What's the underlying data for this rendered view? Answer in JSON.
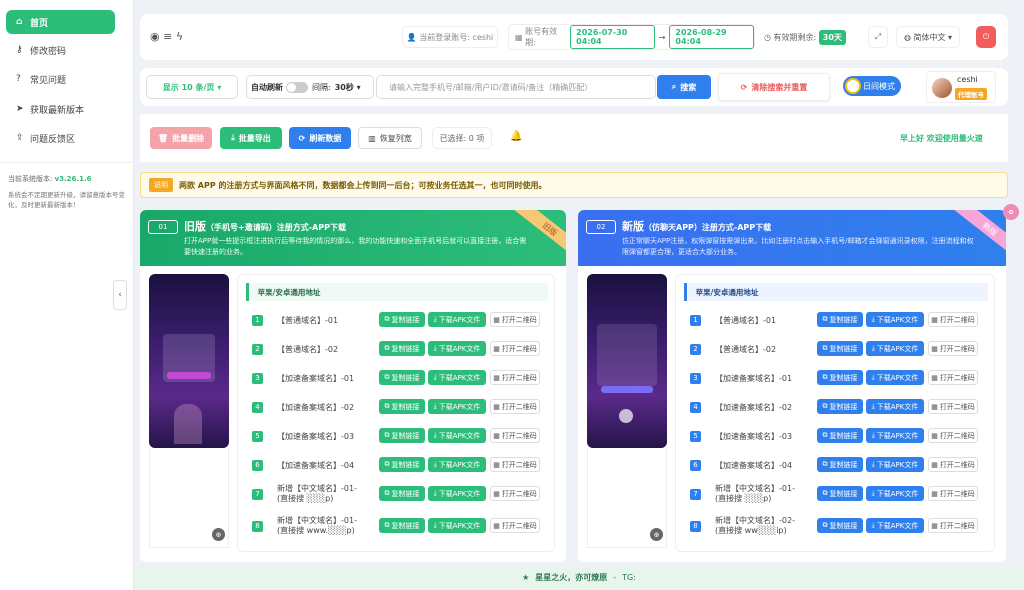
{
  "sidebar": {
    "items": [
      {
        "label": "首页",
        "icon": "home-icon"
      },
      {
        "label": "修改密码",
        "icon": "key-icon"
      },
      {
        "label": "常见问题",
        "icon": "question-icon"
      },
      {
        "label": "获取最新版本",
        "icon": "send-icon"
      },
      {
        "label": "问题反馈区",
        "icon": "upload-icon"
      }
    ],
    "version_label": "当前系统版本:",
    "version": "v3.26.1.6",
    "version_note": "系统会不定期更新升级，请留意版本号变化，及时更新最新版本！"
  },
  "header": {
    "login_label": "当前登录账号:",
    "login_user": "ceshi",
    "validity_label": "账号有效期:",
    "date_start": "2026-07-30 04:04",
    "arrow": "→",
    "date_end": "2026-08-29 04:04",
    "remaining_label": "有效期剩余:",
    "remaining": "30天",
    "language": "简体中文"
  },
  "toolbar": {
    "page_size": "显示 10 条/页",
    "auto_refresh": "自动刷新",
    "interval_label": "间隔:",
    "interval": "30秒",
    "search_placeholder": "请输入完整手机号/邮箱/用户ID/邀请码/备注（精确匹配）",
    "search_btn": "搜索",
    "clear_btn": "清除搜索并重置",
    "mode": "日间模式",
    "user": "ceshi",
    "badge": "代理账号"
  },
  "actions": {
    "batch_delete": "批量删除",
    "batch_export": "批量导出",
    "refresh": "刷新数据",
    "restore_cols": "恢复列宽",
    "selected": "已选择: 0 项",
    "greeting": "早上好 欢迎使用量火速"
  },
  "notice": {
    "tag": "说明",
    "text": "两款 APP 的注册方式与界面风格不同，数据都会上传到同一后台；可按业务任选其一，也可同时使用。"
  },
  "old": {
    "num": "01",
    "title": "旧版",
    "subtitle": "（手机号+邀请码）注册方式-APP下载",
    "desc": "打开APP就一些提示框注进执行后等待我的情况的那么，我的功能快速和全面手机号后就可以直接注册，适合需要快速注册的业务。",
    "ribbon": "旧版",
    "section": "苹果/安卓通用地址",
    "rows": [
      {
        "n": "1",
        "name": "【普通域名】-01"
      },
      {
        "n": "2",
        "name": "【普通域名】-02"
      },
      {
        "n": "3",
        "name": "【加速备案域名】-01"
      },
      {
        "n": "4",
        "name": "【加速备案域名】-02"
      },
      {
        "n": "5",
        "name": "【加速备案域名】-03"
      },
      {
        "n": "6",
        "name": "【加速备案域名】-04"
      },
      {
        "n": "7",
        "name": "新增【中文域名】-01-(直接搜 ░░░p)"
      },
      {
        "n": "8",
        "name": "新增【中文域名】-01-(直接搜 www.░░░p)"
      }
    ]
  },
  "new": {
    "num": "02",
    "title": "新版",
    "subtitle": "（仿聊天APP）注册方式-APP下载",
    "desc": "仿正常聊天APP注册，权限弹窗按需弹出来。比如注册时点击输入手机号/邮箱才会弹窗通讯录权限，注册流程和权限弹窗都更合理，更适合大部分业务。",
    "ribbon": "新版",
    "section": "苹果/安卓通用地址",
    "rows": [
      {
        "n": "1",
        "name": "【普通域名】-01"
      },
      {
        "n": "2",
        "name": "【普通域名】-02"
      },
      {
        "n": "3",
        "name": "【加速备案域名】-01"
      },
      {
        "n": "4",
        "name": "【加速备案域名】-02"
      },
      {
        "n": "5",
        "name": "【加速备案域名】-03"
      },
      {
        "n": "6",
        "name": "【加速备案域名】-04"
      },
      {
        "n": "7",
        "name": "新增【中文域名】-01-(直接搜 ░░░p)"
      },
      {
        "n": "8",
        "name": "新增【中文域名】-02-(直接搜 ww░░░ip)"
      }
    ]
  },
  "row_buttons": {
    "copy": "复制链接",
    "download": "下载APK文件",
    "qr": "打开二维码"
  },
  "footer": {
    "slogan": "星星之火，亦可燎原",
    "sep": "-",
    "tg": "TG:"
  },
  "colors": {
    "green": "#2dbd7a",
    "blue": "#2f80ed",
    "red": "#f07f86",
    "orange": "#f5a623"
  }
}
